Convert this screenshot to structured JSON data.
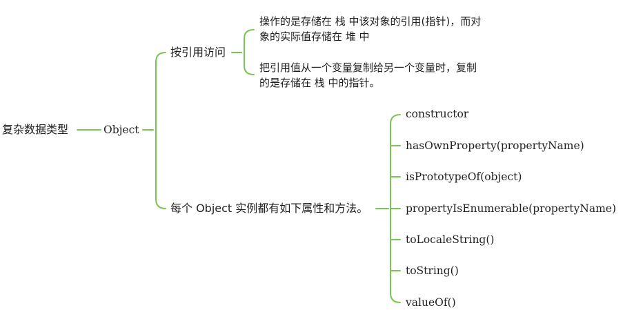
{
  "mindmap": {
    "root": "复杂数据类型",
    "object_node": "Object",
    "access_branch": {
      "label": "按引用访问",
      "notes": [
        [
          "操作的是存储在 栈 中该对象的引用(指针)，而对",
          "象的实际值存储在 堆 中"
        ],
        [
          "把引用值从一个变量复制给另一个变量时，复制",
          "的是存储在 栈 中的指针。"
        ]
      ]
    },
    "members_branch": {
      "label": "每个 Object 实例都有如下属性和方法。",
      "items": [
        "constructor",
        "hasOwnProperty(propertyName)",
        "isPrototypeOf(object)",
        "propertyIsEnumerable(propertyName)",
        "toLocaleString()",
        "toString()",
        "valueOf()"
      ]
    },
    "connector_color": "#78c454"
  }
}
